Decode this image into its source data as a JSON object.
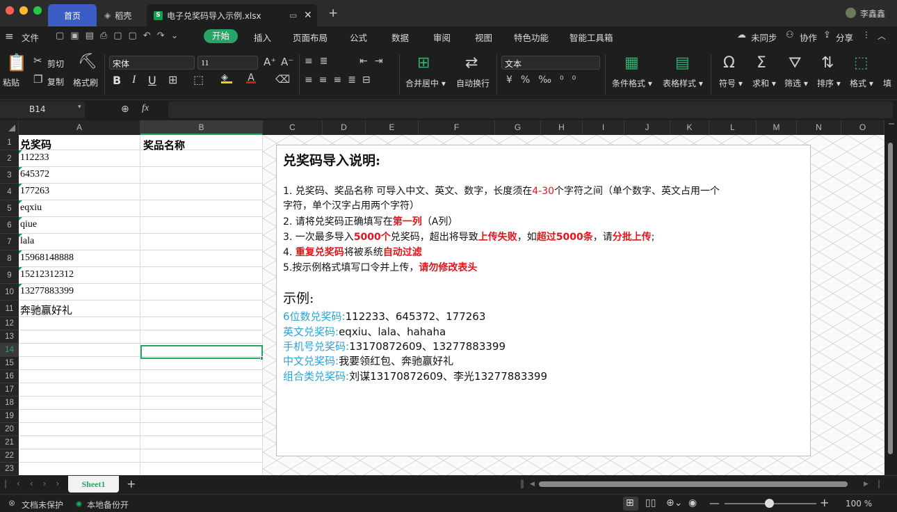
{
  "tabs": {
    "home": "首页",
    "daoke": "稻壳",
    "file": "电子兑奖码导入示例.xlsx",
    "user": "李鑫鑫"
  },
  "menu": {
    "file": "文件",
    "items": [
      "开始",
      "插入",
      "页面布局",
      "公式",
      "数据",
      "审阅",
      "视图",
      "特色功能",
      "智能工具箱"
    ],
    "unsynced": "未同步",
    "collab": "协作",
    "share": "分享"
  },
  "ribbon": {
    "paste": "粘贴",
    "cut": "剪切",
    "copy": "复制",
    "format_painter": "格式刷",
    "font_name": "宋体",
    "font_size": "11",
    "merge": "合并居中",
    "wrap": "自动换行",
    "number_format": "文本",
    "cond_format": "条件格式",
    "table_style": "表格样式",
    "symbol": "符号",
    "sum": "求和",
    "filter": "筛选",
    "sort": "排序",
    "format": "格式",
    "fill": "填"
  },
  "formula_bar": {
    "cell_ref": "B14",
    "fx": "fx",
    "value": ""
  },
  "columns": [
    "A",
    "B",
    "C",
    "D",
    "E",
    "F",
    "G",
    "H",
    "I",
    "J",
    "K",
    "L",
    "M",
    "N",
    "O"
  ],
  "rows": [
    "1",
    "2",
    "3",
    "4",
    "5",
    "6",
    "7",
    "8",
    "9",
    "10",
    "11",
    "12",
    "13",
    "14",
    "15",
    "16",
    "17",
    "18",
    "19",
    "20",
    "21",
    "22",
    "23"
  ],
  "cells": {
    "a": [
      "兑奖码",
      "112233",
      "645372",
      "177263",
      "eqxiu",
      "qiue",
      "lala",
      "15968148888",
      "15212312312",
      "13277883399",
      "奔驰赢好礼"
    ],
    "b1": "奖品名称"
  },
  "textbox": {
    "title": "兑奖码导入说明:",
    "l1a": "1. 兑奖码、奖品名称 可导入中文、英文、数字，长度须在",
    "l1b": "4-30",
    "l1c": "个字符之间（单个数字、英文占用一个",
    "l1d": "字符，单个汉字占用两个字符）",
    "l2a": "2. 请将兑奖码正确填写在",
    "l2b": "第一列",
    "l2c": "（A列）",
    "l3a": "3. 一次最多导入",
    "l3b": "5000个",
    "l3c": "兑奖码，超出将导致",
    "l3d": "上传失败",
    "l3e": "，如",
    "l3f": "超过5000条",
    "l3g": "，请",
    "l3h": "分批上传",
    "l3i": ";",
    "l4a": "4. ",
    "l4b": "重复兑奖码",
    "l4c": "将被系统",
    "l4d": "自动过滤",
    "l5a": "5.按示例格式填写口令并上传，",
    "l5b": "请勿修改表头",
    "example_title": "示例:",
    "ex": [
      {
        "k": "6位数兑奖码:",
        "v": "112233、645372、177263"
      },
      {
        "k": "英文兑奖码:",
        "v": "eqxiu、lala、hahaha"
      },
      {
        "k": "手机号兑奖码:",
        "v": "13170872609、13277883399"
      },
      {
        "k": "中文兑奖码:",
        "v": "我要领红包、奔驰赢好礼"
      },
      {
        "k": "组合类兑奖码:",
        "v": "刘谋13170872609、李光13277883399"
      }
    ]
  },
  "sheet": {
    "name": "Sheet1"
  },
  "status": {
    "protect": "文档未保护",
    "backup": "本地备份开",
    "zoom": "100 %"
  }
}
